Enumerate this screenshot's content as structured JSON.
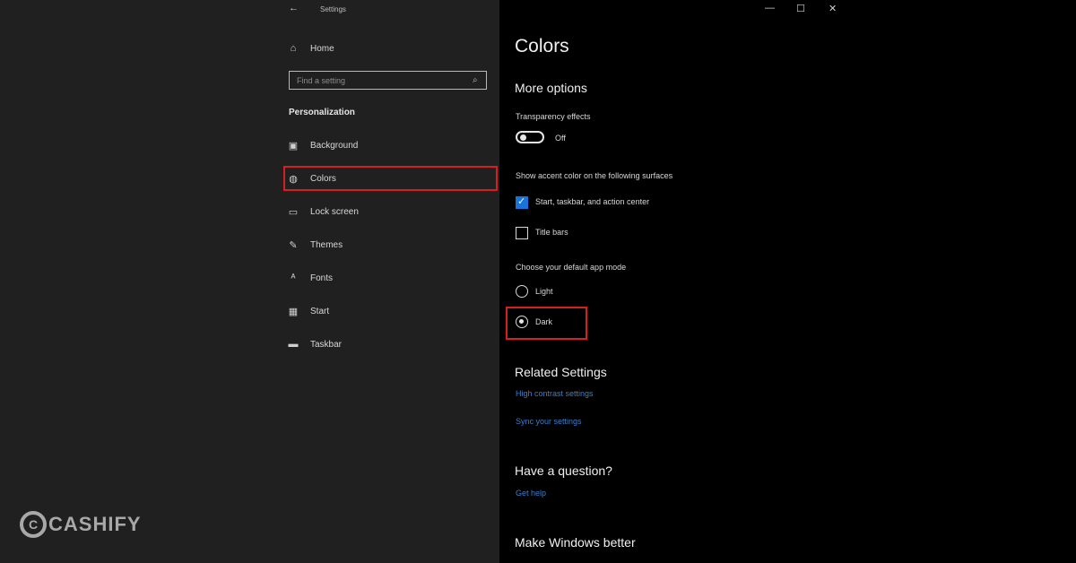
{
  "window": {
    "title": "Settings",
    "back_icon": "back-arrow-icon",
    "controls": {
      "minimize": "—",
      "maximize": "☐",
      "close": "✕"
    }
  },
  "sidebar": {
    "home_label": "Home",
    "search_placeholder": "Find a setting",
    "section": "Personalization",
    "items": [
      {
        "label": "Background",
        "icon": "image-icon"
      },
      {
        "label": "Colors",
        "icon": "palette-icon",
        "selected": true
      },
      {
        "label": "Lock screen",
        "icon": "lock-screen-icon"
      },
      {
        "label": "Themes",
        "icon": "themes-icon"
      },
      {
        "label": "Fonts",
        "icon": "fonts-icon"
      },
      {
        "label": "Start",
        "icon": "start-icon"
      },
      {
        "label": "Taskbar",
        "icon": "taskbar-icon"
      }
    ]
  },
  "main": {
    "title": "Colors",
    "more_options": "More options",
    "transparency_label": "Transparency effects",
    "transparency_state": "Off",
    "accent_surfaces_label": "Show accent color on the following surfaces",
    "checkbox_start": {
      "label": "Start, taskbar, and action center",
      "checked": true
    },
    "checkbox_title": {
      "label": "Title bars",
      "checked": false
    },
    "app_mode_label": "Choose your default app mode",
    "radio_light": "Light",
    "radio_dark": "Dark",
    "app_mode_selected": "Dark",
    "related_settings": "Related Settings",
    "link_high_contrast": "High contrast settings",
    "link_sync": "Sync your settings",
    "question_header": "Have a question?",
    "link_get_help": "Get help",
    "make_better": "Make Windows better"
  },
  "watermark": {
    "text": "CASHIFY",
    "mark": "C"
  },
  "colors": {
    "accent": "#1a73d9",
    "highlight": "#d61f1f",
    "link": "#3b7fcc"
  }
}
